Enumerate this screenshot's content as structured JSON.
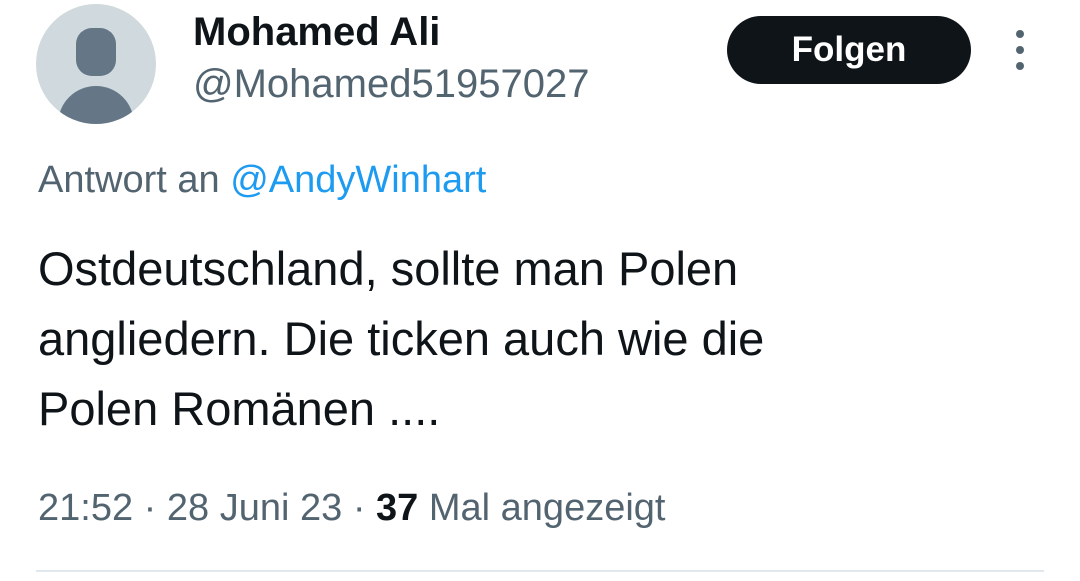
{
  "author": {
    "display_name": "Mohamed Ali",
    "handle": "@Mohamed51957027",
    "avatar_icon": "default-avatar-icon"
  },
  "follow_button": {
    "label": "Folgen"
  },
  "more_menu": {
    "icon": "more-vertical-icon"
  },
  "reply_context": {
    "prefix": "Antwort an",
    "mention": "@AndyWinhart"
  },
  "tweet": {
    "text_lines": [
      "Ostdeutschland, sollte man Polen",
      "angliedern. Die ticken auch wie die",
      "Polen Romänen ...."
    ]
  },
  "meta": {
    "time": "21:52",
    "separator": "·",
    "date": "28 Juni 23",
    "views_count": "37",
    "views_label": "Mal angezeigt"
  },
  "colors": {
    "text_primary": "#0f1419",
    "text_secondary": "#536471",
    "link": "#1d9bf0",
    "button_bg": "#0f1419",
    "avatar_bg": "#cfd9de",
    "avatar_fg": "#657786"
  }
}
